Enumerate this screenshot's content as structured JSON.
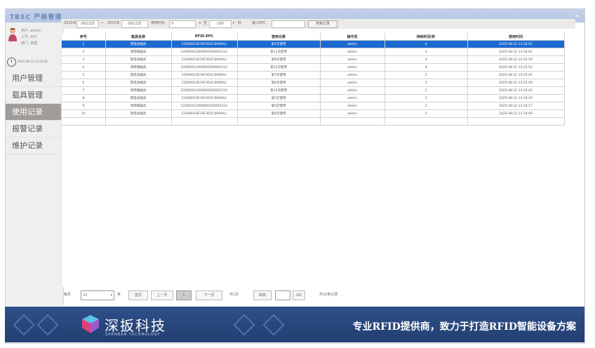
{
  "window": {
    "title": "TBSC 严格管理",
    "minimize_label": "–"
  },
  "user": {
    "line1": "用户: admin",
    "line2": "工号: 001",
    "line3": "部门: 管理",
    "datetime": "2025-08-12 13:34:46"
  },
  "menu": [
    {
      "label": "用户管理"
    },
    {
      "label": "载具管理"
    },
    {
      "label": "使用记录"
    },
    {
      "label": "报警记录"
    },
    {
      "label": "维护记录"
    }
  ],
  "toolbar": {
    "start_year": "2025年",
    "start_date": "08/12日",
    "end_year": "2025年",
    "end_date": "08/12日",
    "times_label": "使用时长",
    "times_min": "0",
    "to_label": "至",
    "times_max": "100",
    "times_unit": "秒",
    "epc_label": "输入EPC",
    "epc_value": "",
    "search_label": "搜索记录"
  },
  "table": {
    "columns": [
      "序号",
      "载具名称",
      "RFID-EPC",
      "使用记录",
      "操作员",
      "持续时间/秒",
      "使用时间"
    ],
    "rows": [
      [
        "1",
        "锂电池载具",
        "E2000016E39F3D2C0006A2",
        "第1次使用",
        "admin",
        "4",
        "2025-08-12 13:36:01"
      ],
      [
        "2",
        "周转箱载具",
        "E20000120000003000E0114",
        "第13次使用",
        "admin",
        "3",
        "2025-08-12 13:36:01"
      ],
      [
        "3",
        "锂电池载具",
        "E2000016E39F3D2C0006A2",
        "第8次使用",
        "admin",
        "4",
        "2025-08-12 13:35:59"
      ],
      [
        "4",
        "周转箱载具",
        "E20000120000003000E0114",
        "第12次使用",
        "admin",
        "4",
        "2025-08-12 13:35:52"
      ],
      [
        "5",
        "锂电池载具",
        "E2000016E39F3D2C0006A2",
        "第7次使用",
        "admin",
        "5",
        "2025-08-12 13:35:41"
      ],
      [
        "6",
        "锂电池载具",
        "E2000016E39F3D2C0006A2",
        "第6次使用",
        "admin",
        "3",
        "2025-08-12 13:35:09"
      ],
      [
        "7",
        "周转箱载具",
        "E20000120000003000E0114",
        "第10次使用",
        "admin",
        "2",
        "2025-08-12 13:34:42"
      ],
      [
        "8",
        "锂电池载具",
        "E2000016E39F3D2C0006A2",
        "第5次使用",
        "admin",
        "3",
        "2025-08-12 13:34:19"
      ],
      [
        "9",
        "周转箱载具",
        "E20000120000003000E0114",
        "第9次使用",
        "admin",
        "2",
        "2025-08-12 13:34:17"
      ],
      [
        "10",
        "锂电池载具",
        "E2000016E39F3D2C0006A2",
        "第4次使用",
        "admin",
        "3",
        "2025-08-12 13:34:09"
      ]
    ]
  },
  "pager": {
    "per_page_label": "每页",
    "per_page_value": "10",
    "per_page_unit": "条",
    "first_label": "首页",
    "prev_label": "上一页",
    "current_page": "1",
    "next_label": "下一页",
    "total_pages": "共1页",
    "jump_label": "跳转",
    "jump_value": "",
    "go_label": "GO",
    "total_records": "共10条记录"
  },
  "banner": {
    "brand_cn": "深扳科技",
    "brand_en": "SHENBAN TECHNOLOGY",
    "slogan": "专业RFID提供商，致力于打造RFID智能设备方案"
  },
  "colors": {
    "title_bar": "#b6c6e4",
    "selected_row": "#1c6ad0",
    "active_menu": "#a09c9a",
    "banner": "#2a4780"
  },
  "icons": [
    "user-avatar-icon",
    "clock-icon",
    "dropdown-icon",
    "spinner-icon",
    "logo-icon"
  ]
}
